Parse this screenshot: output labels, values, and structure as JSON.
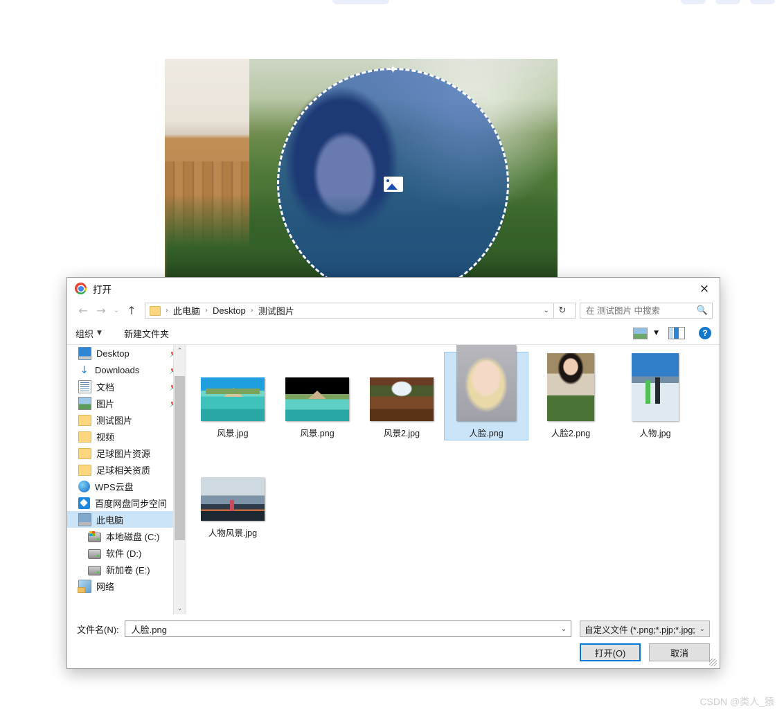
{
  "photo_editor": {
    "crop_shape": "circle",
    "overlay_color": "#1a4db0",
    "handle_icon": "crop-handle-diamond-icon",
    "center_icon": "image-placeholder-icon"
  },
  "dialog": {
    "title": "打开",
    "app_icon": "chrome-icon",
    "close_icon": "×",
    "nav": {
      "back_icon": "←",
      "forward_icon": "→",
      "history_icon": "⌄",
      "up_icon": "↑",
      "refresh_icon": "↻",
      "breadcrumb_caret": "⌄",
      "breadcrumb": [
        "此电脑",
        "Desktop",
        "测试图片"
      ],
      "separator": "›"
    },
    "search": {
      "placeholder": "在 测试图片 中搜索",
      "value": "",
      "icon": "search-icon"
    },
    "toolbar": {
      "organize_label": "组织",
      "organize_caret": "▼",
      "new_folder_label": "新建文件夹",
      "view_icon": "view-layout-icon",
      "view_caret": "▼",
      "preview_pane_icon": "preview-pane-icon",
      "help_icon": "?"
    },
    "sidebar": {
      "items": [
        {
          "label": "Desktop",
          "icon": "desktop-icon",
          "pinned": true,
          "indent": 0,
          "selected": false
        },
        {
          "label": "Downloads",
          "icon": "download-icon",
          "pinned": true,
          "indent": 0,
          "selected": false
        },
        {
          "label": "文档",
          "icon": "documents-icon",
          "pinned": true,
          "indent": 0,
          "selected": false
        },
        {
          "label": "图片",
          "icon": "pictures-icon",
          "pinned": true,
          "indent": 0,
          "selected": false
        },
        {
          "label": "测试图片",
          "icon": "folder-icon",
          "pinned": false,
          "indent": 0,
          "selected": false
        },
        {
          "label": "视频",
          "icon": "folder-icon",
          "pinned": false,
          "indent": 0,
          "selected": false
        },
        {
          "label": "足球图片资源",
          "icon": "folder-icon",
          "pinned": false,
          "indent": 0,
          "selected": false
        },
        {
          "label": "足球相关资质",
          "icon": "folder-icon",
          "pinned": false,
          "indent": 0,
          "selected": false
        },
        {
          "label": "WPS云盘",
          "icon": "wps-cloud-icon",
          "pinned": false,
          "indent": 0,
          "selected": false
        },
        {
          "label": "百度网盘同步空间",
          "icon": "baidu-netdisk-icon",
          "pinned": false,
          "indent": 0,
          "selected": false
        },
        {
          "label": "此电脑",
          "icon": "this-pc-icon",
          "pinned": false,
          "indent": 0,
          "selected": true
        },
        {
          "label": "本地磁盘 (C:)",
          "icon": "system-drive-icon",
          "pinned": false,
          "indent": 1,
          "selected": false
        },
        {
          "label": "软件 (D:)",
          "icon": "drive-icon",
          "pinned": false,
          "indent": 1,
          "selected": false
        },
        {
          "label": "新加卷 (E:)",
          "icon": "drive-icon",
          "pinned": false,
          "indent": 1,
          "selected": false
        },
        {
          "label": "网络",
          "icon": "network-icon",
          "pinned": false,
          "indent": 0,
          "selected": false
        }
      ],
      "scroll_up_icon": "⌃",
      "scroll_down_icon": "⌄",
      "pin_icon": "📌"
    },
    "files": [
      {
        "name": "风景.jpg",
        "thumb": "t-beach",
        "selected": false
      },
      {
        "name": "风景.png",
        "thumb": "t-beachblk",
        "selected": false
      },
      {
        "name": "风景2.jpg",
        "thumb": "t-cave",
        "selected": false
      },
      {
        "name": "人脸.png",
        "thumb": "t-face",
        "selected": true
      },
      {
        "name": "人脸2.png",
        "thumb": "t-face2",
        "selected": false
      },
      {
        "name": "人物.jpg",
        "thumb": "t-person",
        "selected": false
      },
      {
        "name": "人物风景.jpg",
        "thumb": "t-mountain",
        "selected": false
      }
    ],
    "footer": {
      "filename_label": "文件名(N):",
      "filename_value": "人脸.png",
      "filename_caret": "⌄",
      "filter_value": "自定义文件 (*.png;*.pjp;*.jpg;",
      "filter_caret": "⌄",
      "open_label": "打开(O)",
      "cancel_label": "取消"
    }
  },
  "watermark": "CSDN @类人_猿"
}
